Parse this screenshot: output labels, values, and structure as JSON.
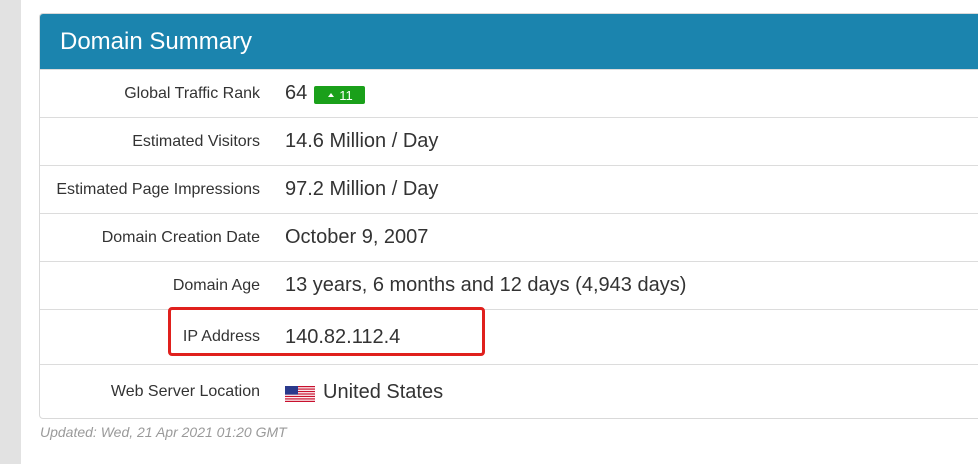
{
  "panel": {
    "title": "Domain Summary"
  },
  "rows": [
    {
      "label": "Global Traffic Rank",
      "value": "64",
      "badge": "11"
    },
    {
      "label": "Estimated Visitors",
      "value": "14.6 Million / Day"
    },
    {
      "label": "Estimated Page Impressions",
      "value": "97.2 Million / Day"
    },
    {
      "label": "Domain Creation Date",
      "value": "October 9, 2007"
    },
    {
      "label": "Domain Age",
      "value": "13 years, 6 months and 12 days (4,943 days)"
    },
    {
      "label": "IP Address",
      "value": "140.82.112.4"
    },
    {
      "label": "Web Server Location",
      "value": "United States",
      "icon": "us-flag-icon"
    }
  ],
  "footer": {
    "updated": "Updated: Wed, 21 Apr 2021 01:20 GMT"
  },
  "colors": {
    "header_bg": "#1b84ae",
    "badge_bg": "#1aa01a",
    "highlight": "#e0201d"
  }
}
